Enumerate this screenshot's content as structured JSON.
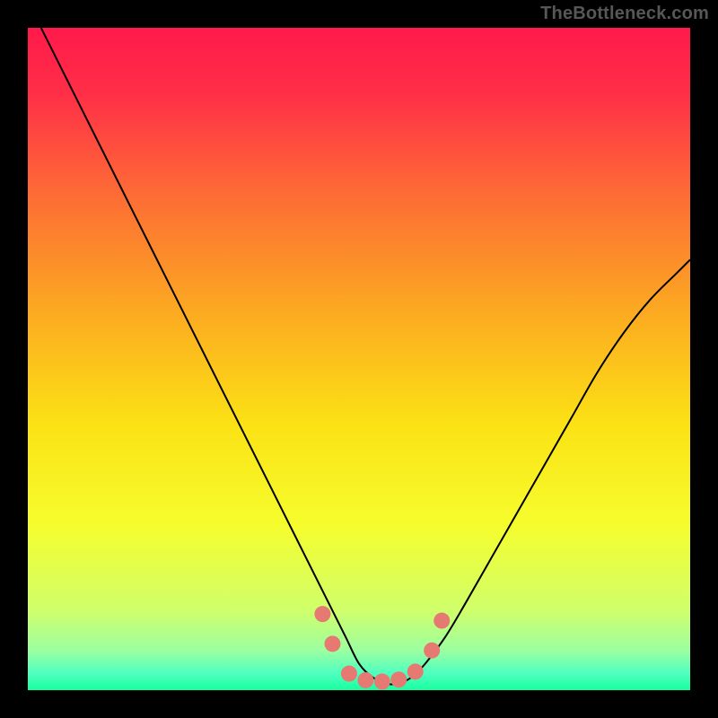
{
  "attribution": "TheBottleneck.com",
  "chart_data": {
    "type": "line",
    "title": "",
    "xlabel": "",
    "ylabel": "",
    "xlim": [
      0,
      100
    ],
    "ylim": [
      0,
      100
    ],
    "background_gradient": {
      "stops": [
        {
          "offset": 0,
          "color": "#ff1a4b"
        },
        {
          "offset": 0.1,
          "color": "#ff2f47"
        },
        {
          "offset": 0.25,
          "color": "#fd6b35"
        },
        {
          "offset": 0.45,
          "color": "#fcb11f"
        },
        {
          "offset": 0.6,
          "color": "#fbe215"
        },
        {
          "offset": 0.75,
          "color": "#f6fd2d"
        },
        {
          "offset": 0.88,
          "color": "#cfff6b"
        },
        {
          "offset": 0.94,
          "color": "#9cffa0"
        },
        {
          "offset": 0.975,
          "color": "#4effc0"
        },
        {
          "offset": 1.0,
          "color": "#17ff9d"
        }
      ]
    },
    "series": [
      {
        "name": "bottleneck-curve",
        "color": "#000000",
        "stroke_width": 2,
        "x": [
          2,
          5,
          8,
          12,
          16,
          20,
          24,
          28,
          32,
          36,
          40,
          44,
          46,
          48,
          50,
          52,
          54,
          56,
          58,
          60,
          63,
          66,
          70,
          74,
          78,
          82,
          86,
          90,
          94,
          98,
          100
        ],
        "y": [
          100,
          94,
          88,
          80,
          72,
          64,
          56,
          48,
          40,
          32,
          24,
          16,
          12,
          8,
          4,
          2,
          1,
          1,
          2,
          4,
          8,
          13,
          20,
          27,
          34,
          41,
          48,
          54,
          59,
          63,
          65
        ]
      }
    ],
    "markers": {
      "name": "highlight-dots",
      "color": "#e67a72",
      "radius": 9,
      "points": [
        {
          "x": 44.5,
          "y": 11.5
        },
        {
          "x": 46.0,
          "y": 7.0
        },
        {
          "x": 48.5,
          "y": 2.5
        },
        {
          "x": 51.0,
          "y": 1.5
        },
        {
          "x": 53.5,
          "y": 1.3
        },
        {
          "x": 56.0,
          "y": 1.6
        },
        {
          "x": 58.5,
          "y": 2.8
        },
        {
          "x": 61.0,
          "y": 6.0
        },
        {
          "x": 62.5,
          "y": 10.5
        }
      ]
    }
  }
}
